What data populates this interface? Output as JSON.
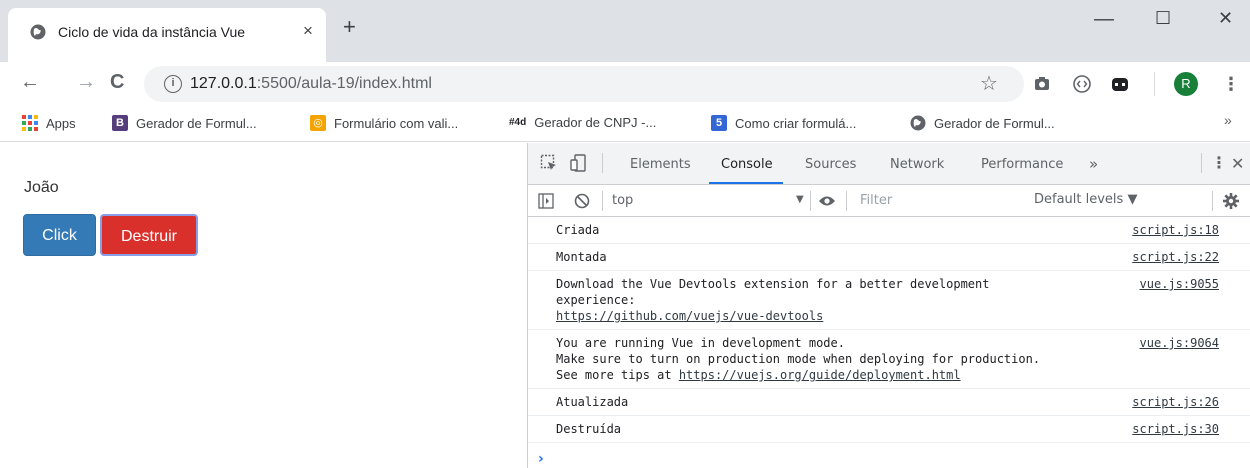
{
  "tab": {
    "title": "Ciclo de vida da instância Vue",
    "close": "×",
    "new_tab": "+"
  },
  "window": {
    "minimize": "—",
    "maximize": "☐",
    "close": "✕"
  },
  "toolbar": {
    "back": "←",
    "forward": "→",
    "reload": "C",
    "url_host": "127.0.0.1",
    "url_rest": ":5500/aula-19/index.html",
    "profile_initial": "R"
  },
  "bookmarks": {
    "items": [
      {
        "label": "Apps",
        "color": "#ea4335"
      },
      {
        "label": "Gerador de Formul...",
        "color": "#563d7c",
        "badge": "B"
      },
      {
        "label": "Formulário com vali...",
        "color": "#f4a300",
        "badge": "◎"
      },
      {
        "label": "Gerador de CNPJ -...",
        "badge": "#4d"
      },
      {
        "label": "Como criar formulá...",
        "color": "#3367d6",
        "badge": "5"
      },
      {
        "label": "Gerador de Formul..."
      }
    ],
    "more": "»"
  },
  "page": {
    "name": "João",
    "click_label": "Click",
    "destroy_label": "Destruir"
  },
  "devtools": {
    "tabs": [
      "Elements",
      "Console",
      "Sources",
      "Network",
      "Performance"
    ],
    "more_tabs": "»",
    "context": "top",
    "filter_placeholder": "Filter",
    "levels": "Default levels ▼",
    "messages": [
      {
        "text": "Criada",
        "source": "script.js:18"
      },
      {
        "text": "Montada",
        "source": "script.js:22"
      },
      {
        "text": "Download the Vue Devtools extension for a better development\nexperience:",
        "link": "https://github.com/vuejs/vue-devtools",
        "source": "vue.js:9055"
      },
      {
        "text": "You are running Vue in development mode.\nMake sure to turn on production mode when deploying for production.\nSee more tips at ",
        "link": "https://vuejs.org/guide/deployment.html",
        "inline_link": true,
        "source": "vue.js:9064"
      },
      {
        "text": "Atualizada",
        "source": "script.js:26"
      },
      {
        "text": "Destruída",
        "source": "script.js:30"
      }
    ],
    "prompt": "›"
  }
}
